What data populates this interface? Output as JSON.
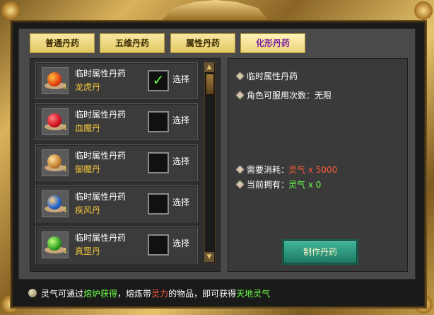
{
  "colors": {
    "tab_active_text": "#7b1fa2",
    "item_name_primary": "#f2c43a",
    "checkmark": "#66ff44",
    "red_value": "#ff5a3a",
    "green_value": "#6cff4a",
    "craft_button": "#2a9a7e"
  },
  "tabs": [
    {
      "label": "普通丹药"
    },
    {
      "label": "五维丹药"
    },
    {
      "label": "属性丹药"
    },
    {
      "label": "化形丹药"
    }
  ],
  "items": [
    {
      "type_label": "临时属性丹药",
      "name": "龙虎丹",
      "qty": "1",
      "checked": "✓",
      "select_label": "选择",
      "icon": "red-orange-pill-icon"
    },
    {
      "type_label": "临时属性丹药",
      "name": "血魔丹",
      "qty": "1",
      "checked": "",
      "select_label": "选择",
      "icon": "red-pill-icon"
    },
    {
      "type_label": "临时属性丹药",
      "name": "御魔丹",
      "qty": "1",
      "checked": "",
      "select_label": "选择",
      "icon": "amber-pill-icon"
    },
    {
      "type_label": "临时属性丹药",
      "name": "疾风丹",
      "qty": "1",
      "checked": "",
      "select_label": "选择",
      "icon": "blue-pill-icon"
    },
    {
      "type_label": "临时属性丹药",
      "name": "真罡丹",
      "qty": "1",
      "checked": "",
      "select_label": "选择",
      "icon": "green-pill-icon"
    }
  ],
  "detail": {
    "type": "临时属性丹药",
    "use_limit": "角色可服用次数：无限",
    "cost_label": "需要消耗：",
    "cost_value": "灵气 x 5000",
    "own_label": "当前拥有：",
    "own_value": "灵气 x 0",
    "craft_button": "制作丹药"
  },
  "tip": {
    "part1": "灵气可通过",
    "part2": "熔炉获得",
    "part3": "，熔炼带",
    "part4": "灵力",
    "part5": "的物品，即可获得",
    "part6": "天地灵气"
  }
}
